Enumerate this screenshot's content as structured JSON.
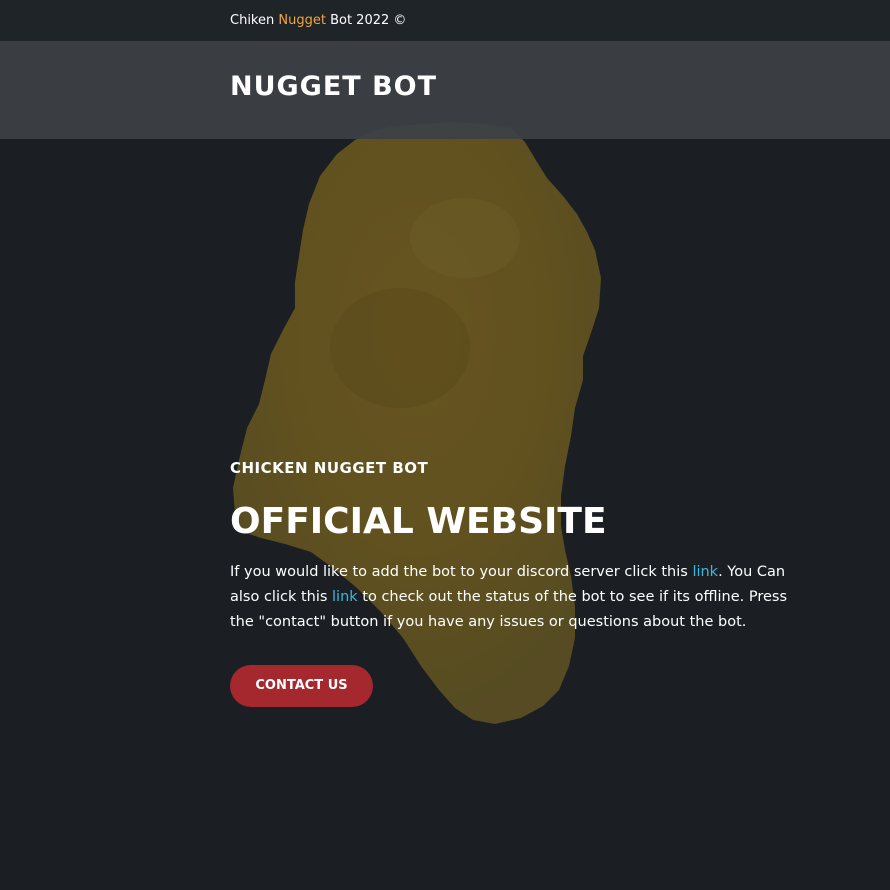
{
  "topbar": {
    "prefix": "Chiken ",
    "accent_word": "Nugget",
    "suffix": " Bot 2022 ©"
  },
  "navbar": {
    "brand": "NUGGET BOT"
  },
  "hero": {
    "eyebrow": "CHICKEN NUGGET BOT",
    "headline": "OFFICIAL WEBSITE",
    "desc_part1": "If you would like to add the bot to your discord server click this ",
    "link1": "link",
    "desc_part2": ". You Can also click this ",
    "link2": "link",
    "desc_part3": " to check out the status of the bot to see if its offline. Press the \"contact\" button if you have any issues or questions about the bot.",
    "cta_label": "CONTACT US"
  },
  "colors": {
    "background": "#1b1f23",
    "topbar": "#1f2429",
    "navbar": "#3d4145",
    "accent": "#f0a540",
    "link": "#3fb6dc",
    "button": "#a4282e",
    "nugget": "#6b5a22"
  },
  "icons": {
    "background_image": "chicken-nugget-image"
  }
}
